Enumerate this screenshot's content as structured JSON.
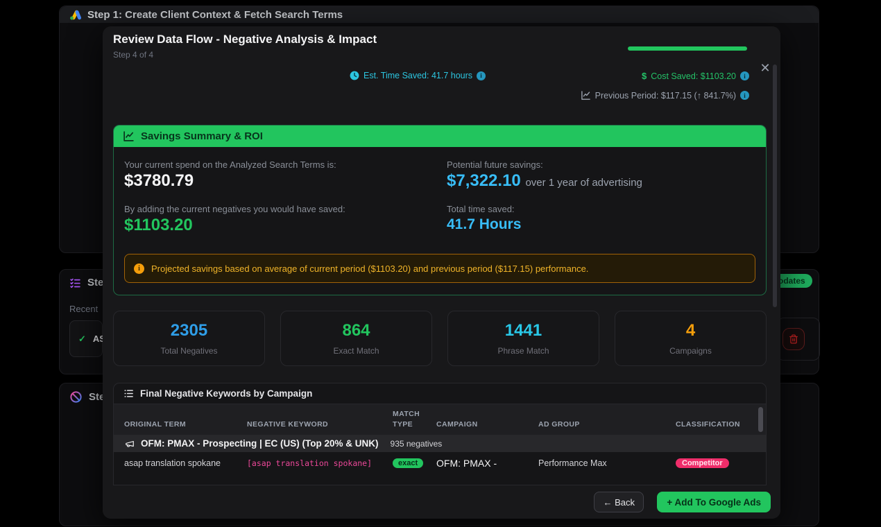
{
  "colors": {
    "accent_green": "#22c55e",
    "accent_cyan": "#29c8e8",
    "accent_sky": "#38bdf8",
    "accent_blue": "#2f9ee8",
    "accent_amber": "#f59e0b",
    "keyword_pink": "#ec4899",
    "classification_rose": "#ef2d6a"
  },
  "background": {
    "step1": {
      "title": "Step 1: Create Client Context & Fetch Search Terms"
    },
    "step2": {
      "title_fragment": "Ste",
      "recent_label_fragment": "Recent",
      "item_label_fragment": "AS",
      "badge_fragment": "odates"
    },
    "step3": {
      "title_fragment": "Ste"
    }
  },
  "modal": {
    "title": "Review Data Flow - Negative Analysis & Impact",
    "step_indicator": "Step 4 of 4",
    "close_glyph": "✕",
    "stats": {
      "time_saved": "Est. Time Saved: 41.7 hours",
      "cost_saved_icon": "$",
      "cost_saved": "Cost Saved: $1103.20",
      "previous_period": "Previous Period: $117.15 (↑ 841.7%)",
      "info_glyph": "i"
    },
    "savings": {
      "title": "Savings Summary & ROI",
      "current_spend_label": "Your current spend on the Analyzed Search Terms is:",
      "current_spend_value": "$3780.79",
      "future_label": "Potential future savings:",
      "future_value": "$7,322.10",
      "future_suffix": "over 1 year of advertising",
      "saved_label": "By adding the current negatives you would have saved:",
      "saved_value": "$1103.20",
      "time_label": "Total time saved:",
      "time_value": "41.7 Hours",
      "warning_text": "Projected savings based on average of current period ($1103.20) and previous period ($117.15) performance."
    },
    "stat_cards": [
      {
        "value": "2305",
        "label": "Total Negatives"
      },
      {
        "value": "864",
        "label": "Exact Match"
      },
      {
        "value": "1441",
        "label": "Phrase Match"
      },
      {
        "value": "4",
        "label": "Campaigns"
      }
    ],
    "table": {
      "title": "Final Negative Keywords by Campaign",
      "columns": [
        "ORIGINAL TERM",
        "NEGATIVE KEYWORD",
        "MATCH TYPE",
        "CAMPAIGN",
        "AD GROUP",
        "CLASSIFICATION"
      ],
      "group": {
        "name": "OFM: PMAX - Prospecting | EC (US) (Top 20% & UNK)",
        "count": "935 negatives"
      },
      "rows": [
        {
          "original_term": "asap translation spokane",
          "negative_keyword": "[asap translation spokane]",
          "match_type": "exact",
          "campaign": "OFM: PMAX -",
          "ad_group": "Performance Max",
          "classification": "Competitor"
        }
      ]
    },
    "footer": {
      "back": "← Back",
      "add": "+ Add To Google Ads"
    }
  }
}
